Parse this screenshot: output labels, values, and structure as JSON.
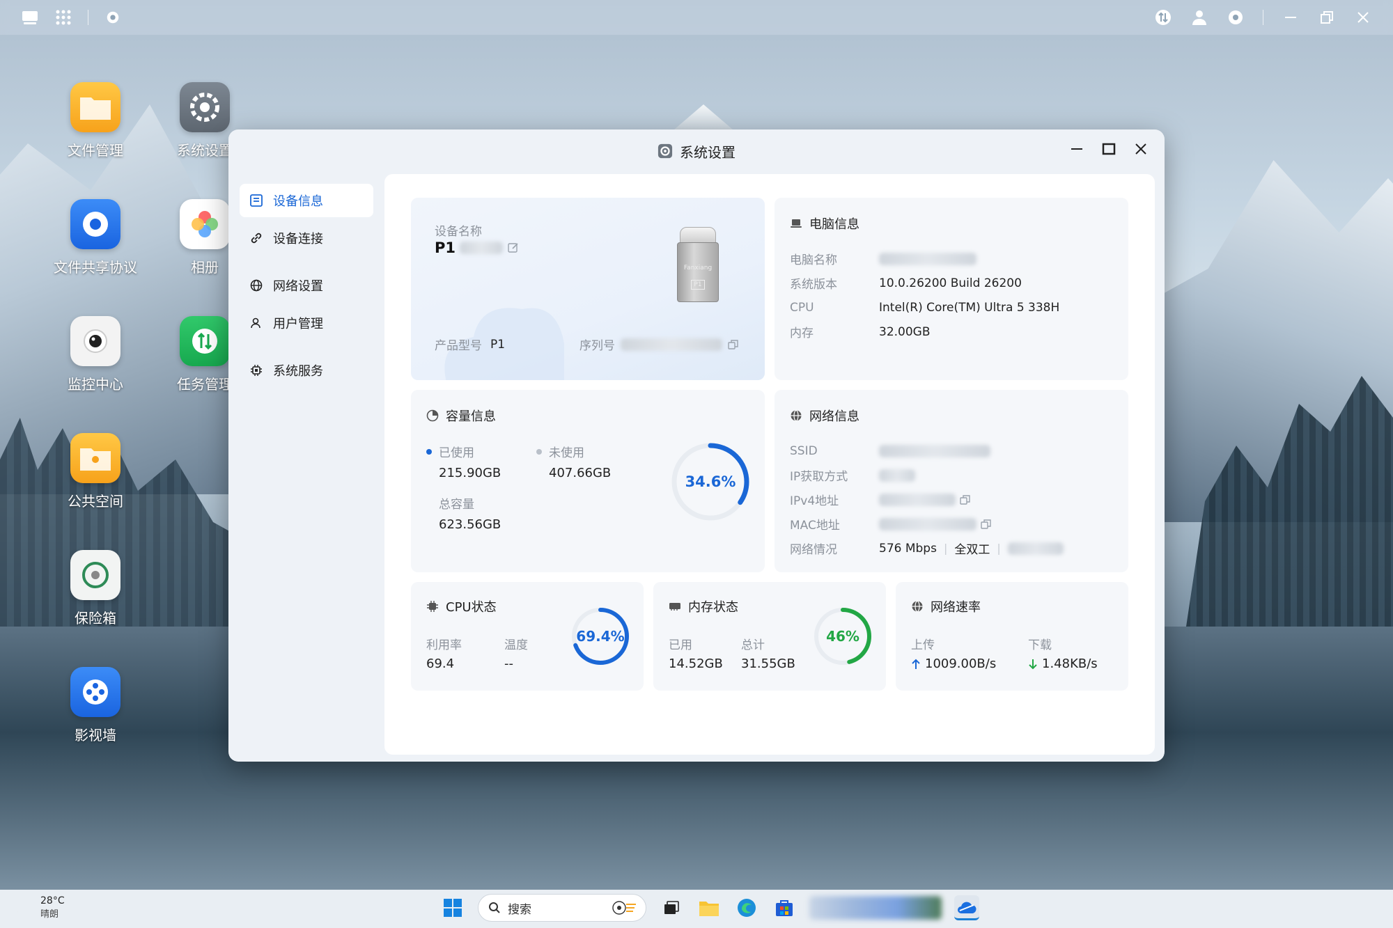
{
  "desktop": {
    "icons": [
      {
        "label": "文件管理"
      },
      {
        "label": "系统设置"
      },
      {
        "label": "文件共享协议"
      },
      {
        "label": "相册"
      },
      {
        "label": "监控中心"
      },
      {
        "label": "任务管理"
      },
      {
        "label": "公共空间"
      },
      {
        "label": "保险箱"
      },
      {
        "label": "影视墙"
      }
    ]
  },
  "window": {
    "title": "系统设置",
    "sidebar": [
      {
        "label": "设备信息",
        "icon": "device-info-icon",
        "active": true
      },
      {
        "label": "设备连接",
        "icon": "link-icon"
      },
      {
        "label": "网络设置",
        "icon": "globe-icon"
      },
      {
        "label": "用户管理",
        "icon": "user-icon"
      },
      {
        "label": "系统服务",
        "icon": "chip-icon"
      }
    ],
    "device": {
      "name_label": "设备名称",
      "name_value": "P1",
      "model_label": "产品型号",
      "model_value": "P1",
      "serial_label": "序列号",
      "product_badge_brand": "Fanxiang",
      "product_badge_model": "P1"
    },
    "pc_info": {
      "title": "电脑信息",
      "rows": [
        {
          "label": "电脑名称",
          "value": ""
        },
        {
          "label": "系统版本",
          "value": "10.0.26200 Build 26200"
        },
        {
          "label": "CPU",
          "value": "Intel(R) Core(TM) Ultra 5 338H"
        },
        {
          "label": "内存",
          "value": "32.00GB"
        }
      ]
    },
    "capacity": {
      "title": "容量信息",
      "used_label": "已使用",
      "used_value": "215.90GB",
      "free_label": "未使用",
      "free_value": "407.66GB",
      "total_label": "总容量",
      "total_value": "623.56GB",
      "percent_text": "34.6%",
      "percent": 0.346
    },
    "network_info": {
      "title": "网络信息",
      "ssid_label": "SSID",
      "ip_mode_label": "IP获取方式",
      "ipv4_label": "IPv4地址",
      "mac_label": "MAC地址",
      "status_label": "网络情况",
      "speed": "576 Mbps",
      "duplex": "全双工"
    },
    "cpu": {
      "title": "CPU状态",
      "util_label": "利用率",
      "util_value": "69.4",
      "temp_label": "温度",
      "temp_value": "--",
      "percent_text": "69.4%",
      "percent": 0.694
    },
    "memory": {
      "title": "内存状态",
      "used_label": "已用",
      "used_value": "14.52GB",
      "total_label": "总计",
      "total_value": "31.55GB",
      "percent_text": "46%",
      "percent": 0.46
    },
    "net_speed": {
      "title": "网络速率",
      "up_label": "上传",
      "up_value": "1009.00B/s",
      "down_label": "下载",
      "down_value": "1.48KB/s"
    }
  },
  "taskbar": {
    "temperature": "28°C",
    "weather": "晴朗",
    "search_placeholder": "搜索"
  },
  "colors": {
    "accent": "#1a67d6",
    "green": "#22a745",
    "ring_track": "#e8ecf1"
  }
}
